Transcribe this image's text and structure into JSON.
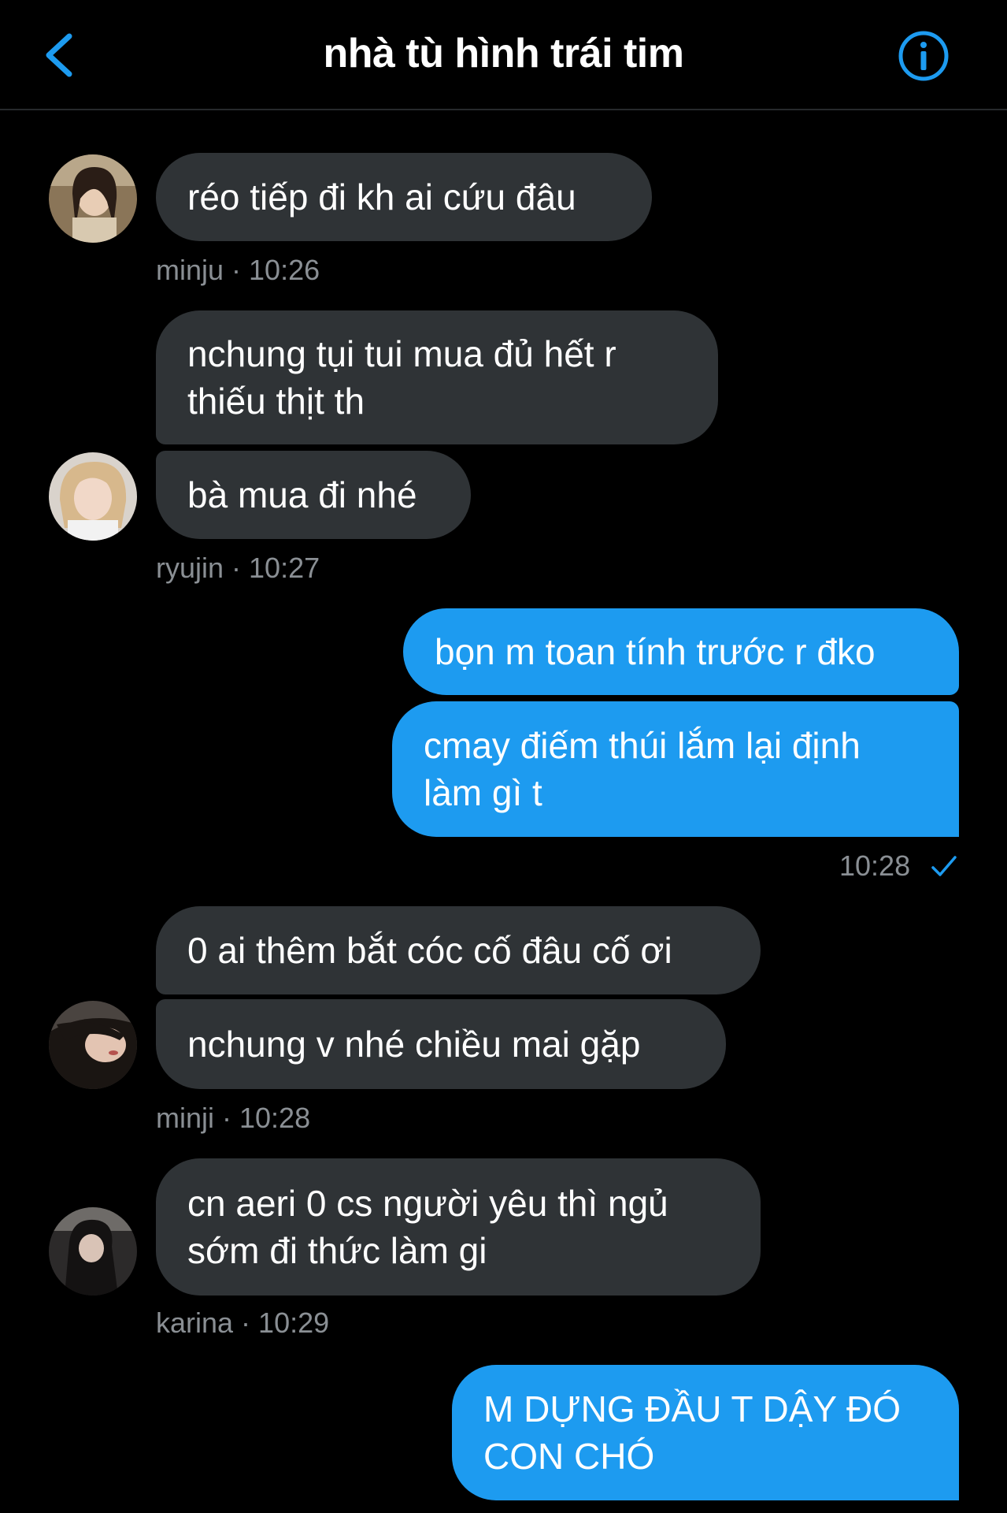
{
  "header": {
    "title": "nhà tù hình trái tim",
    "back_icon": "chevron-left-icon",
    "info_icon": "info-circle-icon"
  },
  "colors": {
    "background": "#000000",
    "incoming_bubble": "#2f3336",
    "outgoing_bubble": "#1d9bf0",
    "accent": "#1d9bf0",
    "meta_text": "#8a8f94"
  },
  "messages": {
    "m1": {
      "text": "réo tiếp đi kh ai cứu đâu"
    },
    "m1_meta": "minju · 10:26",
    "m2": {
      "text": "nchung tụi tui mua đủ hết r\nthiếu thịt th"
    },
    "m3": {
      "text": "bà mua đi nhé"
    },
    "m3_meta": "ryujin · 10:27",
    "m4": {
      "text": "bọn m toan tính trước r đko"
    },
    "m5": {
      "text": "cmay điếm thúi lắm lại định\nlàm gì t"
    },
    "m5_time": "10:28",
    "m6": {
      "text": "0 ai thêm bắt cóc cố đâu cố ơi"
    },
    "m7": {
      "text": "nchung v nhé chiều mai gặp"
    },
    "m7_meta": "minji · 10:28",
    "m8": {
      "text": "cn aeri 0 cs người yêu thì ngủ\nsớm đi thức làm gi"
    },
    "m8_meta": "karina · 10:29",
    "m9": {
      "text": "M DỰNG ĐẦU T DẬY ĐÓ\nCON CHÓ"
    }
  }
}
